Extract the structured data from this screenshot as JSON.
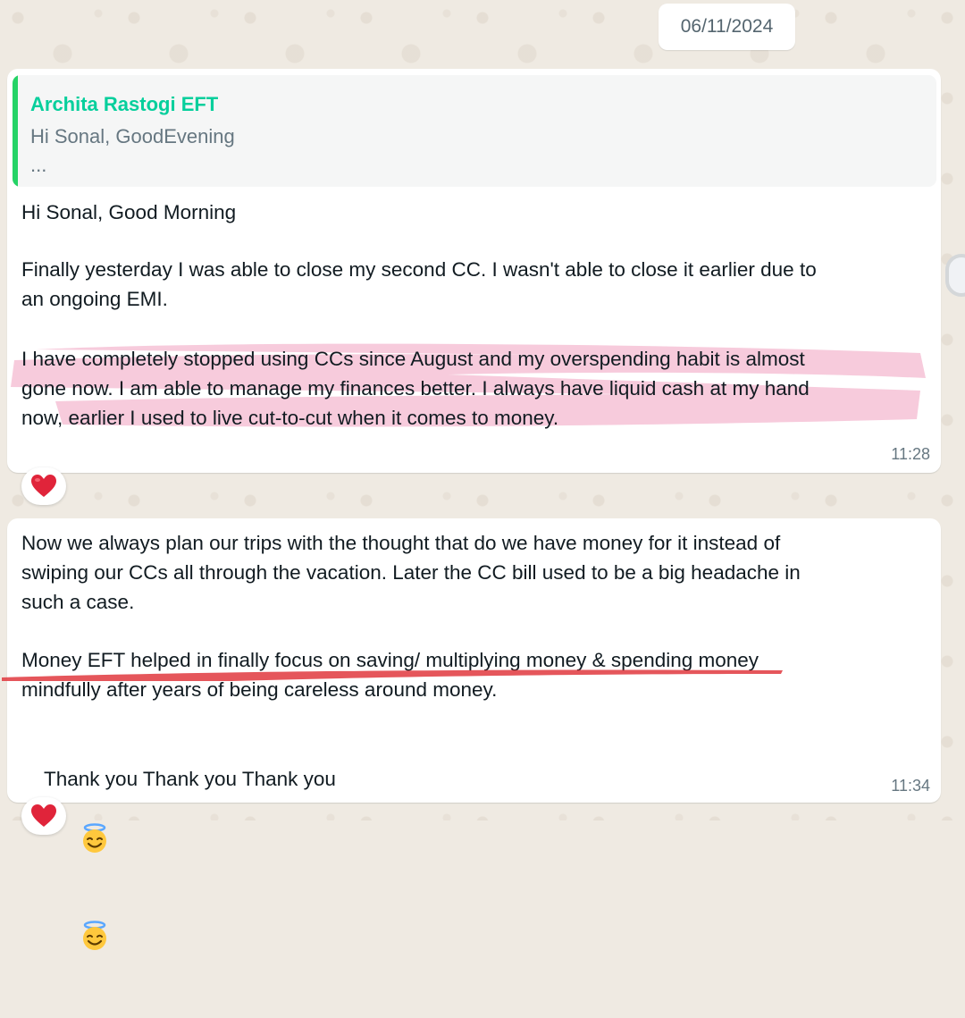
{
  "date_chip": "06/11/2024",
  "messages": [
    {
      "quote": {
        "author": "Archita Rastogi EFT",
        "text": "Hi Sonal, GoodEvening",
        "ellipsis": "..."
      },
      "paragraphs": [
        "Hi Sonal, Good Morning",
        "Finally yesterday I was able to close my second CC. I wasn't able to close it earlier due to\nan ongoing EMI.",
        "I have completely stopped using CCs since August and my overspending habit is almost\ngone now. I am able to manage my finances better. I always have liquid cash at my hand\nnow, earlier I used to live cut-to-cut when it comes to money."
      ],
      "time": "11:28",
      "reaction": "heart",
      "highlight_color": "#f5bcd2"
    },
    {
      "paragraphs": [
        "Now we always plan our trips with the thought that do we have money for it instead of\nswiping our CCs all through the vacation. Later the CC bill used to be a big headache in\nsuch a case.",
        "Money EFT helped in finally focus on saving/ multiplying money & spending money\nmindfully after years of being careless around money.",
        "Thank you Thank you Thank you"
      ],
      "emoji": [
        "smiling-face-with-halo",
        "smiling-face-with-halo"
      ],
      "time": "11:34",
      "reaction": "heart",
      "underline_color": "#e0383e"
    }
  ],
  "colors": {
    "wallpaper": "#efeae2",
    "bubble": "#ffffff",
    "quote_bar": "#25d366",
    "quote_author": "#06cf9c",
    "secondary_text": "#667781",
    "heart": "#e0243a"
  }
}
